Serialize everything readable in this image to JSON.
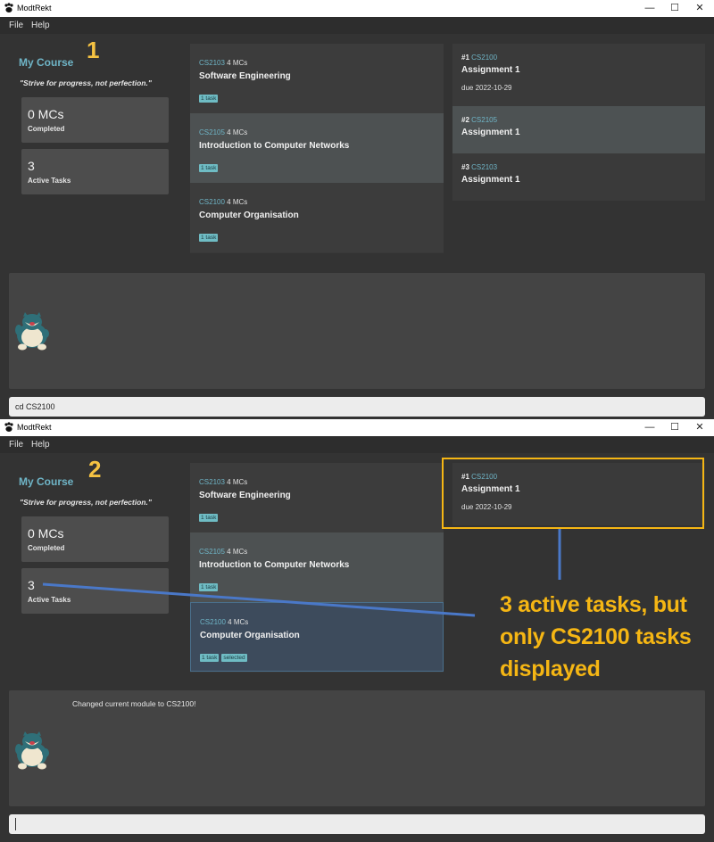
{
  "app": {
    "title": "ModtRekt"
  },
  "window_controls": {
    "minimize": "—",
    "maximize": "☐",
    "close": "✕"
  },
  "menu": {
    "file": "File",
    "help": "Help"
  },
  "sidebar": {
    "course_title": "My Course",
    "quote": "\"Strive for progress, not perfection.\"",
    "mcs_value": "0 MCs",
    "mcs_label": "Completed",
    "tasks_value": "3",
    "tasks_label": "Active Tasks"
  },
  "modules": [
    {
      "code": "CS2103",
      "mcs": "4 MCs",
      "name": "Software Engineering",
      "tags": [
        "1 task"
      ]
    },
    {
      "code": "CS2105",
      "mcs": "4 MCs",
      "name": "Introduction to Computer Networks",
      "tags": [
        "1 task"
      ]
    },
    {
      "code": "CS2100",
      "mcs": "4 MCs",
      "name": "Computer Organisation",
      "tags": [
        "1 task"
      ]
    }
  ],
  "selected_tag": "selected",
  "tasks_before": [
    {
      "index": "#1",
      "code": "CS2100",
      "name": "Assignment 1",
      "due": "due 2022-10-29"
    },
    {
      "index": "#2",
      "code": "CS2105",
      "name": "Assignment 1",
      "due": ""
    },
    {
      "index": "#3",
      "code": "CS2103",
      "name": "Assignment 1",
      "due": ""
    }
  ],
  "tasks_after": [
    {
      "index": "#1",
      "code": "CS2100",
      "name": "Assignment 1",
      "due": "due 2022-10-29"
    }
  ],
  "result_after": "Changed current module to CS2100!",
  "command_before": "cd CS2100",
  "command_after": "",
  "steps": {
    "one": "1",
    "two": "2"
  },
  "annotation": {
    "line1": "3 active tasks, but",
    "line2": "only CS2100 tasks",
    "line3": "displayed"
  },
  "colors": {
    "accent": "#6fb5c7",
    "annotation": "#f5b614",
    "arrow": "#4a78c8",
    "background": "#333333"
  },
  "icons": {
    "app": "paw-icon",
    "mascot": "snorlax-icon"
  }
}
